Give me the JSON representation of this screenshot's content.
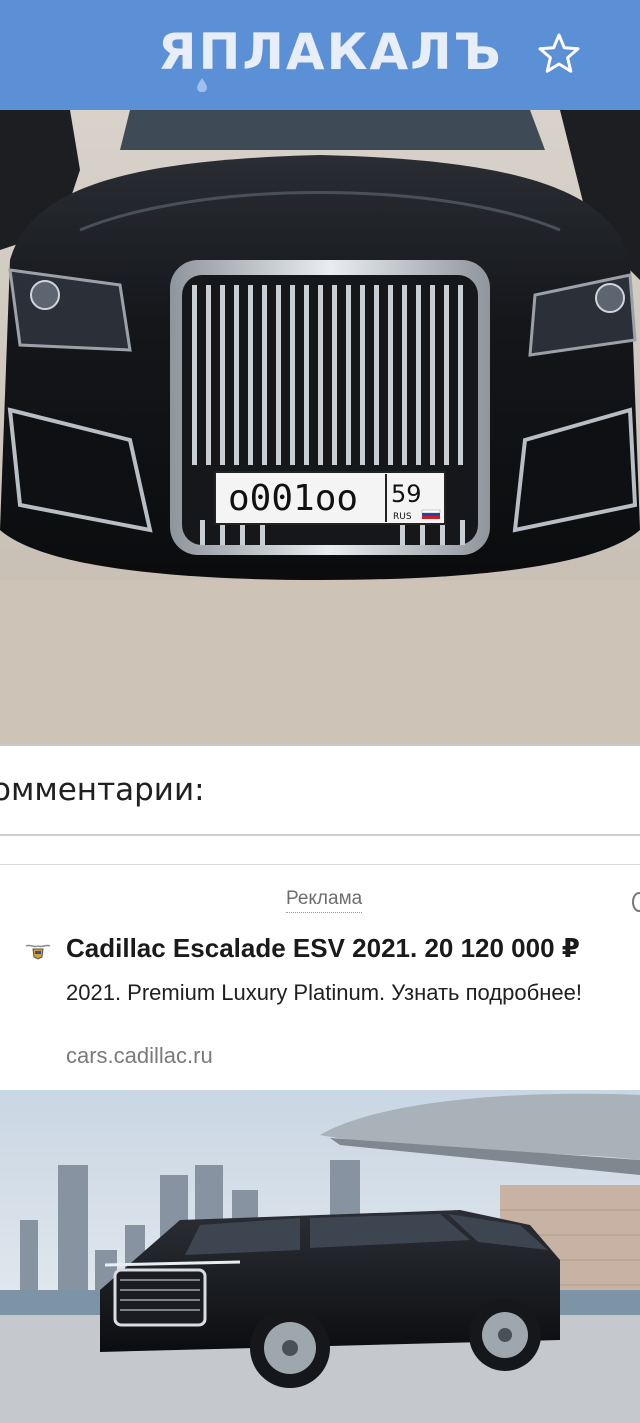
{
  "header": {
    "logo_text": "ЯПЛАКАЛЪ",
    "star_icon": "star-icon",
    "bg_color": "#5b8fd6"
  },
  "post_image": {
    "plate_number": "о001оо",
    "plate_region": "59",
    "plate_country": "RUS"
  },
  "comments": {
    "title": "омментарии:"
  },
  "ad": {
    "label": "Реклама",
    "title": "Cadillac Escalade ESV 2021. 20 120 000 ₽",
    "description": "2021. Premium Luxury Platinum. Узнать подробнее!",
    "domain": "cars.cadillac.ru",
    "brand_icon": "cadillac-logo-icon"
  }
}
